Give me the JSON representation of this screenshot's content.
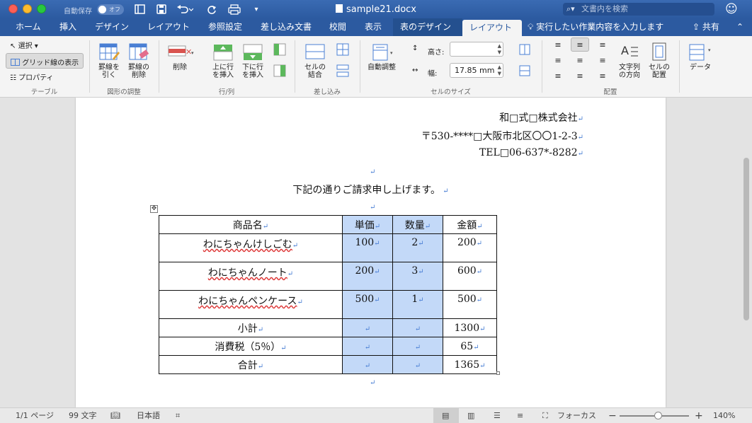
{
  "titlebar": {
    "autosave_label": "自動保存",
    "autosave_state": "オフ",
    "doc_title": "sample21.docx",
    "search_placeholder": "文書内を検索"
  },
  "tabs": [
    "ホーム",
    "挿入",
    "デザイン",
    "レイアウト",
    "参照設定",
    "差し込み文書",
    "校閲",
    "表示",
    "表のデザイン",
    "レイアウト"
  ],
  "active_tab": "レイアウト",
  "tell_me": "実行したい作業内容を入力します",
  "share": "共有",
  "ribbon": {
    "table": {
      "select": "選択",
      "gridlines": "グリッド線の表示",
      "properties": "プロパティ",
      "label": "テーブル"
    },
    "draw": {
      "draw_table_l1": "罫線を",
      "draw_table_l2": "引く",
      "eraser_l1": "罫線の",
      "eraser_l2": "削除",
      "label": "図形の調整"
    },
    "rows_cols": {
      "delete": "削除",
      "insert_above_l1": "上に行",
      "insert_above_l2": "を挿入",
      "insert_below_l1": "下に行",
      "insert_below_l2": "を挿入",
      "label": "行/列"
    },
    "merge": {
      "merge_l1": "セルの",
      "merge_l2": "結合",
      "label": "差し込み"
    },
    "cell_size": {
      "autofit": "自動調整",
      "height_label": "高さ:",
      "height_value": "",
      "width_label": "幅:",
      "width_value": "17.85 mm",
      "label": "セルのサイズ"
    },
    "alignment": {
      "text_dir_l1": "文字列",
      "text_dir_l2": "の方向",
      "margins_l1": "セルの",
      "margins_l2": "配置",
      "label": "配置"
    },
    "data": {
      "data": "データ"
    }
  },
  "document": {
    "company": "和□式□株式会社",
    "address": "〒530-****□大阪市北区〇〇1-2-3",
    "tel": "TEL□06-637*-8282",
    "greeting": "下記の通りご請求申し上げます。",
    "table": {
      "headers": [
        "商品名",
        "単価",
        "数量",
        "金額"
      ],
      "rows": [
        {
          "name": "わにちゃんけしごむ",
          "price": "100",
          "qty": "2",
          "amount": "200"
        },
        {
          "name": "わにちゃんノート",
          "price": "200",
          "qty": "3",
          "amount": "600"
        },
        {
          "name": "わにちゃんペンケース",
          "price": "500",
          "qty": "1",
          "amount": "500"
        }
      ],
      "summary": [
        {
          "label": "小計",
          "amount": "1300"
        },
        {
          "label": "消費税（5％）",
          "amount": "65"
        },
        {
          "label": "合計",
          "amount": "1365"
        }
      ]
    }
  },
  "statusbar": {
    "pages": "1/1 ページ",
    "words": "99 文字",
    "language": "日本語",
    "focus": "フォーカス",
    "zoom": "140%",
    "zoom_level_percent": 140
  },
  "colors": {
    "ribbon_blue": "#2c5aa0",
    "selection": "#c3d9f8",
    "paragraph_mark": "#4a7fd4"
  }
}
